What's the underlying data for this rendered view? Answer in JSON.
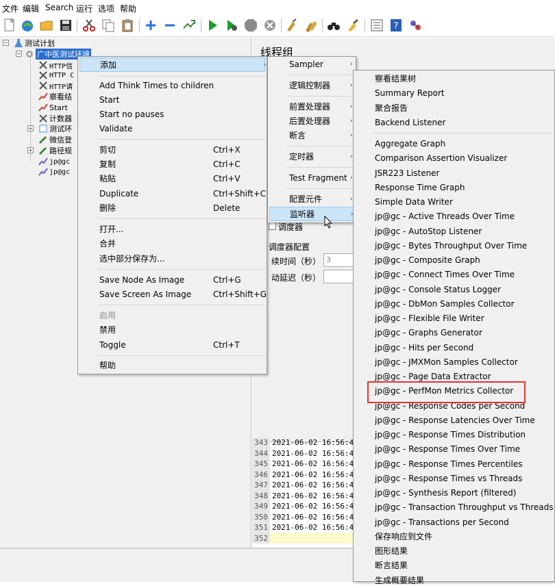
{
  "menubar": {
    "items": [
      "文件",
      "编辑",
      "Search",
      "运行",
      "选项",
      "帮助"
    ]
  },
  "toolbar": {
    "buttons": [
      "new-icon",
      "templates-icon",
      "open-icon",
      "save-icon",
      "cut-icon",
      "copy-icon",
      "paste-icon",
      "expand-icon",
      "collapse-icon",
      "toggle-icon",
      "start-icon",
      "start-no-pause-icon",
      "stop-icon",
      "shutdown-icon",
      "clear-icon",
      "clear-all-icon",
      "search-icon",
      "reset-search-icon",
      "function-helper-icon",
      "help-icon",
      "remote-icon"
    ]
  },
  "tree": {
    "root": "测试计划",
    "thread_group": "广中医测试环境",
    "children": [
      "HTTP信",
      "HTTP C",
      "HTTP请",
      "察看结",
      "Start",
      "计数器",
      "测试环",
      "微信登",
      "路径规",
      "jp@gc",
      "jp@gc"
    ]
  },
  "content": {
    "title": "线程组",
    "scheduler_label": "调度器",
    "scheduler_config": "调度器配置",
    "duration_label": "续时间（秒）",
    "duration_value": "3",
    "startup_delay_label": "动延迟（秒）"
  },
  "log": {
    "rows": [
      {
        "num": "343",
        "text": "2021-06-02 16:56:4"
      },
      {
        "num": "344",
        "text": "2021-06-02 16:56:4"
      },
      {
        "num": "345",
        "text": "2021-06-02 16:56:4"
      },
      {
        "num": "346",
        "text": "2021-06-02 16:56:4"
      },
      {
        "num": "347",
        "text": "2021-06-02 16:56:4"
      },
      {
        "num": "348",
        "text": "2021-06-02 16:56:4"
      },
      {
        "num": "349",
        "text": "2021-06-02 16:56:4"
      },
      {
        "num": "350",
        "text": "2021-06-02 16:56:4"
      },
      {
        "num": "351",
        "text": "2021-06-02 16:56:4"
      },
      {
        "num": "352",
        "text": ""
      }
    ]
  },
  "context_menu": {
    "items": [
      {
        "label": "添加",
        "accel": "",
        "submenu": true
      },
      {
        "label": "Add Think Times to children",
        "accel": ""
      },
      {
        "label": "Start",
        "accel": ""
      },
      {
        "label": "Start no pauses",
        "accel": ""
      },
      {
        "label": "Validate",
        "accel": ""
      },
      {
        "label": "剪切",
        "accel": "Ctrl+X"
      },
      {
        "label": "复制",
        "accel": "Ctrl+C"
      },
      {
        "label": "粘贴",
        "accel": "Ctrl+V"
      },
      {
        "label": "Duplicate",
        "accel": "Ctrl+Shift+C"
      },
      {
        "label": "删除",
        "accel": "Delete"
      },
      {
        "label": "打开...",
        "accel": ""
      },
      {
        "label": "合并",
        "accel": ""
      },
      {
        "label": "选中部分保存为...",
        "accel": ""
      },
      {
        "label": "Save Node As Image",
        "accel": "Ctrl+G"
      },
      {
        "label": "Save Screen As Image",
        "accel": "Ctrl+Shift+G"
      },
      {
        "label": "启用",
        "accel": "",
        "disabled": true
      },
      {
        "label": "禁用",
        "accel": ""
      },
      {
        "label": "Toggle",
        "accel": "Ctrl+T"
      },
      {
        "label": "帮助",
        "accel": ""
      }
    ]
  },
  "add_submenu": {
    "items": [
      "Sampler",
      "逻辑控制器",
      "前置处理器",
      "后置处理器",
      "断言",
      "定时器",
      "Test Fragment",
      "配置元件",
      "监听器"
    ]
  },
  "listener_submenu": {
    "items": [
      "察看结果树",
      "Summary Report",
      "聚合报告",
      "Backend Listener",
      "Aggregate Graph",
      "Comparison Assertion Visualizer",
      "JSR223 Listener",
      "Response Time Graph",
      "Simple Data Writer",
      "jp@gc - Active Threads Over Time",
      "jp@gc - AutoStop Listener",
      "jp@gc - Bytes Throughput Over Time",
      "jp@gc - Composite Graph",
      "jp@gc - Connect Times Over Time",
      "jp@gc - Console Status Logger",
      "jp@gc - DbMon Samples Collector",
      "jp@gc - Flexible File Writer",
      "jp@gc - Graphs Generator",
      "jp@gc - Hits per Second",
      "jp@gc - JMXMon Samples Collector",
      "jp@gc - Page Data Extractor",
      "jp@gc - PerfMon Metrics Collector",
      "jp@gc - Response Codes per Second",
      "jp@gc - Response Latencies Over Time",
      "jp@gc - Response Times Distribution",
      "jp@gc - Response Times Over Time",
      "jp@gc - Response Times Percentiles",
      "jp@gc - Response Times vs Threads",
      "jp@gc - Synthesis Report (filtered)",
      "jp@gc - Transaction Throughput vs Threads",
      "jp@gc - Transactions per Second",
      "保存响应到文件",
      "图形结果",
      "断言结果",
      "生成概要结果"
    ]
  },
  "colors": {
    "highlight": "#cce4f7",
    "selection": "#2a6ecf",
    "annotation_red": "#e3342f"
  }
}
